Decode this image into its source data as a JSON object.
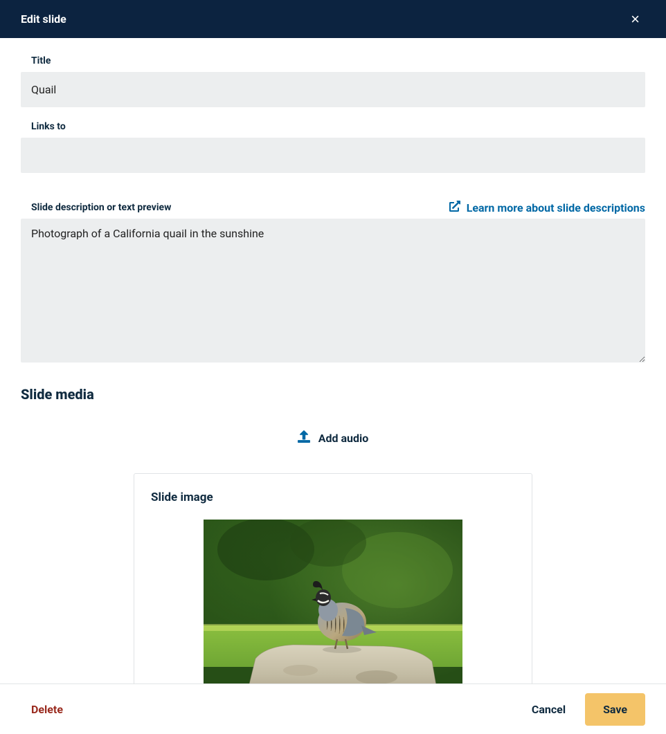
{
  "header": {
    "title": "Edit slide"
  },
  "fields": {
    "title_label": "Title",
    "title_value": "Quail",
    "links_label": "Links to",
    "links_value": "",
    "desc_label": "Slide description or text preview",
    "desc_value": "Photograph of a California quail in the sunshine",
    "learn_more": "Learn more about slide descriptions"
  },
  "media": {
    "section_title": "Slide media",
    "add_audio": "Add audio",
    "image_card_title": "Slide image"
  },
  "footer": {
    "delete": "Delete",
    "cancel": "Cancel",
    "save": "Save"
  }
}
